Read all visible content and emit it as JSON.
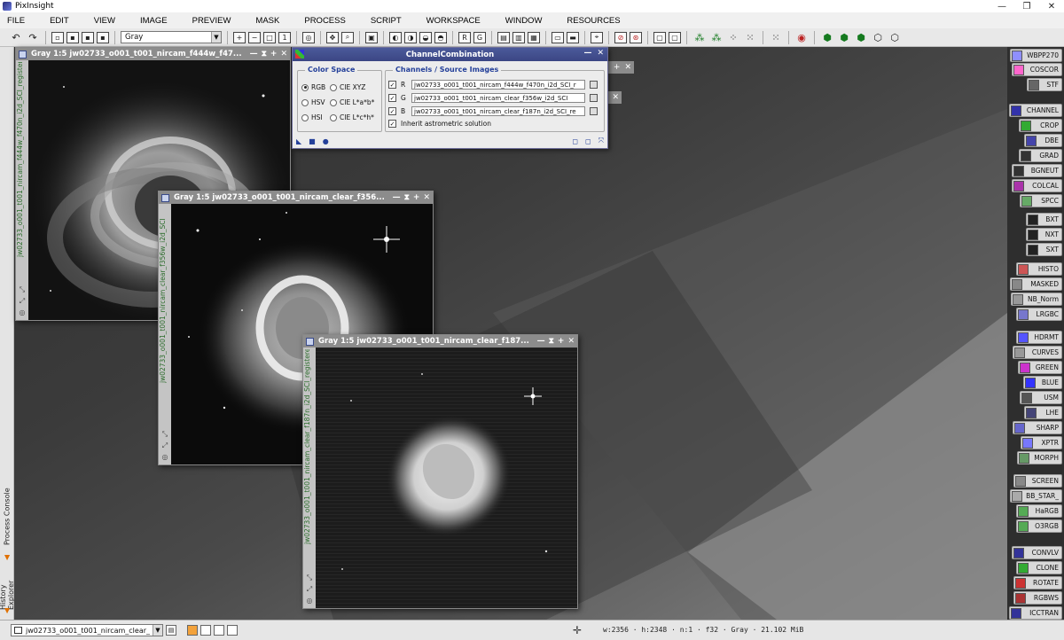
{
  "app": {
    "title": "PixInsight",
    "icon": "pixinsight-icon"
  },
  "menu": [
    "FILE",
    "EDIT",
    "VIEW",
    "IMAGE",
    "PREVIEW",
    "MASK",
    "PROCESS",
    "SCRIPT",
    "WORKSPACE",
    "WINDOW",
    "RESOURCES"
  ],
  "toolbar": {
    "colorspace_select": "Gray"
  },
  "windows": [
    {
      "title": "Gray 1:5 jw02733_o001_t001_nircam_f444w_f47...",
      "side_title": "jw02733_o001_t001_nircam_f444w_f470n_i2d_SCI_registered"
    },
    {
      "title": "Gray 1:5 jw02733_o001_t001_nircam_clear_f356...",
      "side_title": "jw02733_o001_t001_nircam_clear_f356w_i2d_SCI"
    },
    {
      "title": "Gray 1:5 jw02733_o001_t001_nircam_clear_f187...",
      "side_title": "jw02733_o001_t001_nircam_clear_f187n_i2d_SCI_registered"
    }
  ],
  "dialog": {
    "title": "ChannelCombination",
    "color_space_title": "Color Space",
    "color_spaces": [
      {
        "label": "RGB",
        "selected": true
      },
      {
        "label": "CIE XYZ",
        "selected": false
      },
      {
        "label": "HSV",
        "selected": false
      },
      {
        "label": "CIE L*a*b*",
        "selected": false
      },
      {
        "label": "HSI",
        "selected": false
      },
      {
        "label": "CIE L*c*h*",
        "selected": false
      }
    ],
    "channels_title": "Channels / Source Images",
    "channels": [
      {
        "channel": "R",
        "image": "jw02733_o001_t001_nircam_f444w_f470n_i2d_SCI_r"
      },
      {
        "channel": "G",
        "image": "jw02733_o001_t001_nircam_clear_f356w_i2d_SCI"
      },
      {
        "channel": "B",
        "image": "jw02733_o001_t001_nircam_clear_f187n_i2d_SCI_re"
      }
    ],
    "inherit_label": "Inherit astrometric solution"
  },
  "left_tabs": {
    "process_console": "Process Console",
    "history_explorer": "History Explorer"
  },
  "process_icons": [
    "WBPP270",
    "COSCOR",
    "STF",
    "CHANNEL",
    "CROP",
    "DBE",
    "GRAD",
    "BGNEUT",
    "COLCAL",
    "SPCC",
    "BXT",
    "NXT",
    "SXT",
    "HISTO",
    "MASKED",
    "NB_Norm",
    "LRGBC",
    "HDRMT",
    "CURVES",
    "GREEN",
    "BLUE",
    "USM",
    "LHE",
    "SHARP",
    "XPTR",
    "MORPH",
    "SCREEN",
    "BB_STAR_",
    "HaRGB",
    "O3RGB",
    "CONVLV",
    "CLONE",
    "ROTATE",
    "RGBWS",
    "ICCTRAN"
  ],
  "statusbar": {
    "view": "jw02733_o001_t001_nircam_clear_",
    "info": "w:2356 · h:2348 · n:1 · f32 · Gray · 21.102 MiB"
  }
}
